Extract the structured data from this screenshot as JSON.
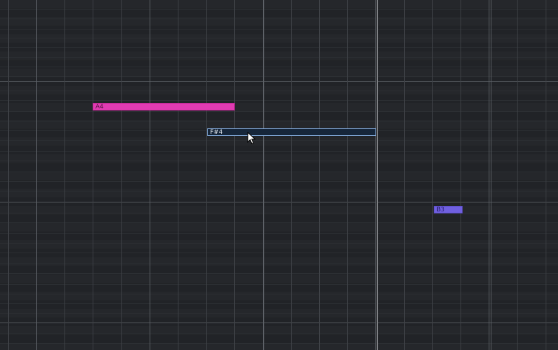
{
  "piano_roll": {
    "notes": [
      {
        "label": "A4",
        "color": "#e13bb2",
        "selected": false
      },
      {
        "label": "F#4",
        "color": "#16263a",
        "selected": true
      },
      {
        "label": "B3",
        "color": "#7060e0",
        "selected": false
      }
    ]
  },
  "icons": {
    "cursor": "mouse-pointer-icon"
  }
}
